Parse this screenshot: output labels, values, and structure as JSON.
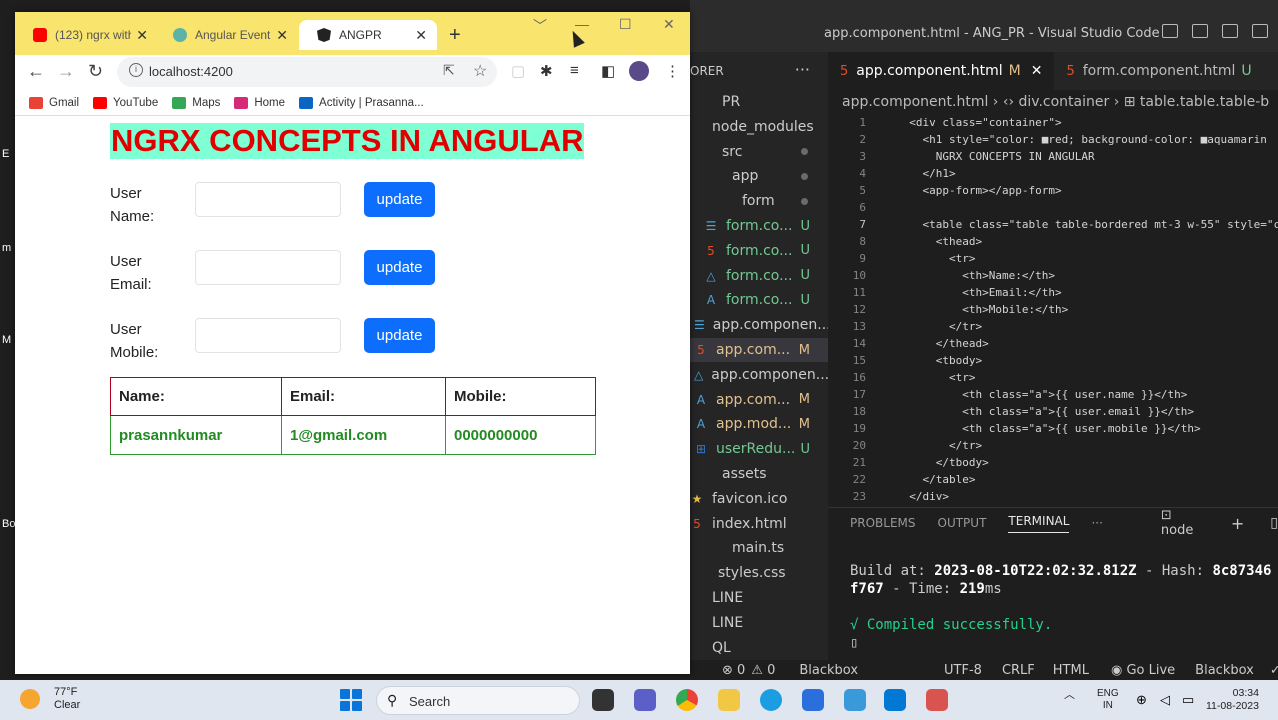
{
  "vscode": {
    "title": "app.component.html - ANG_PR - Visual Studio Code",
    "explorer_header": "ORER",
    "explorer_more": "···",
    "tree": [
      {
        "label": "PR",
        "icon": "",
        "badge": ""
      },
      {
        "label": "node_modules",
        "icon": "folder",
        "badge": ""
      },
      {
        "label": "src",
        "icon": "folder",
        "badge": "dot"
      },
      {
        "label": "app",
        "icon": "folder",
        "badge": "dot"
      },
      {
        "label": "form",
        "icon": "folder",
        "badge": "dot"
      },
      {
        "label": "form.co...",
        "icon": "css",
        "badge": "U"
      },
      {
        "label": "form.co...",
        "icon": "html",
        "badge": "U"
      },
      {
        "label": "form.co...",
        "icon": "test",
        "badge": "U"
      },
      {
        "label": "form.co...",
        "icon": "angular",
        "badge": "U"
      },
      {
        "label": "app.componen...",
        "icon": "css",
        "badge": ""
      },
      {
        "label": "app.com...",
        "icon": "html",
        "badge": "M"
      },
      {
        "label": "app.componen...",
        "icon": "test",
        "badge": ""
      },
      {
        "label": "app.com...",
        "icon": "angular",
        "badge": "M"
      },
      {
        "label": "app.mod...",
        "icon": "angular",
        "badge": "M"
      },
      {
        "label": "userRedu...",
        "icon": "ts",
        "badge": "U"
      },
      {
        "label": "assets",
        "icon": "folder",
        "badge": ""
      },
      {
        "label": "favicon.ico",
        "icon": "star",
        "badge": ""
      },
      {
        "label": "index.html",
        "icon": "html",
        "badge": ""
      },
      {
        "label": "main.ts",
        "icon": "",
        "badge": ""
      },
      {
        "label": "styles.css",
        "icon": "",
        "badge": ""
      },
      {
        "label": "LINE",
        "icon": "",
        "badge": ""
      },
      {
        "label": "LINE",
        "icon": "",
        "badge": ""
      },
      {
        "label": "QL",
        "icon": "",
        "badge": ""
      }
    ],
    "tabs": [
      {
        "label": "app.component.html",
        "badge": "M",
        "close": "✕"
      },
      {
        "label": "form.component.html",
        "badge": "U"
      }
    ],
    "breadcrumb": "app.component.html  › ‹› div.container › ⊞ table.table.table-b",
    "code_lines": [
      {
        "n": "1",
        "text": "  <div class=\"container\">"
      },
      {
        "n": "2",
        "text": "    <h1 style=\"color: ■red; background-color: ■aquamarin"
      },
      {
        "n": "3",
        "text": "      NGRX CONCEPTS IN ANGULAR"
      },
      {
        "n": "4",
        "text": "    </h1>"
      },
      {
        "n": "5",
        "text": "    <app-form></app-form>"
      },
      {
        "n": "6",
        "text": ""
      },
      {
        "n": "7",
        "text": "    <table class=\"table table-bordered mt-3 w-55\" style=\"c"
      },
      {
        "n": "8",
        "text": "      <thead>"
      },
      {
        "n": "9",
        "text": "        <tr>"
      },
      {
        "n": "10",
        "text": "          <th>Name:</th>"
      },
      {
        "n": "11",
        "text": "          <th>Email:</th>"
      },
      {
        "n": "12",
        "text": "          <th>Mobile:</th>"
      },
      {
        "n": "13",
        "text": "        </tr>"
      },
      {
        "n": "14",
        "text": "      </thead>"
      },
      {
        "n": "15",
        "text": "      <tbody>"
      },
      {
        "n": "16",
        "text": "        <tr>"
      },
      {
        "n": "17",
        "text": "          <th class=\"a\">{{ user.name }}</th>"
      },
      {
        "n": "18",
        "text": "          <th class=\"a\">{{ user.email }}</th>"
      },
      {
        "n": "19",
        "text": "          <th class=\"a\">{{ user.mobile }}</th>"
      },
      {
        "n": "20",
        "text": "        </tr>"
      },
      {
        "n": "21",
        "text": "      </tbody>"
      },
      {
        "n": "22",
        "text": "    </table>"
      },
      {
        "n": "23",
        "text": "  </div>"
      }
    ],
    "panel_tabs": [
      "PROBLEMS",
      "OUTPUT",
      "TERMINAL",
      "···"
    ],
    "panel_active": "TERMINAL",
    "terminal_shell": "node",
    "terminal": {
      "build_label": "Build at: ",
      "build_time": "2023-08-10T22:02:32.812Z",
      "hash_label": " - Hash: ",
      "hash_a": "8c87346",
      "hash_b": "f767",
      "time_label": " - Time: ",
      "time_value": "219",
      "time_unit": "ms",
      "compiled": "√ Compiled successfully."
    },
    "status": {
      "errors": "⊗ 0",
      "warnings": "⚠ 0",
      "left_app": "Blackbox",
      "encoding": "UTF-8",
      "eol": "CRLF",
      "language": "HTML",
      "golive": "Go Live",
      "right_app": "Blackbox",
      "prettier": "✓ Pr"
    }
  },
  "chrome": {
    "tabs": [
      {
        "title": "(123) ngrx with",
        "favicon_color": "#ff0000"
      },
      {
        "title": "Angular Event B",
        "favicon_color": "#5cb3a6"
      },
      {
        "title": "ANGPR",
        "favicon_color": "#222222"
      }
    ],
    "new_tab": "+",
    "window_buttons": [
      "﹀",
      "—",
      "☐",
      "✕"
    ],
    "url": "localhost:4200",
    "bookmarks": [
      {
        "label": "Gmail",
        "color": "#ea4335"
      },
      {
        "label": "YouTube",
        "color": "#ff0000"
      },
      {
        "label": "Maps",
        "color": "#34a853"
      },
      {
        "label": "Home",
        "color": "#d62976"
      },
      {
        "label": "Activity | Prasanna...",
        "color": "#0a66c2"
      }
    ]
  },
  "app": {
    "title": "NGRX CONCEPTS IN ANGULAR",
    "fields": [
      {
        "label": "User Name:",
        "value": "",
        "button": "update"
      },
      {
        "label": "User Email:",
        "value": "",
        "button": "update"
      },
      {
        "label": "User Mobile:",
        "value": "",
        "button": "update"
      }
    ],
    "table": {
      "headers": [
        "Name:",
        "Email:",
        "Mobile:"
      ],
      "rows": [
        [
          "prasannkumar",
          "1@gmail.com",
          "0000000000"
        ]
      ]
    },
    "colors": {
      "title_fg": "#ff0000",
      "title_bg": "#7fffd4",
      "button": "#0d6efd",
      "row_text": "#228b22"
    }
  },
  "desktop_fragments": [
    "E",
    "m",
    "M",
    "Bo"
  ],
  "taskbar": {
    "weather_temp": "77°F",
    "weather_desc": "Clear",
    "search_placeholder": "Search",
    "lang_line1": "ENG",
    "lang_line2": "IN",
    "time": "03:34",
    "date": "11-08-2023"
  }
}
